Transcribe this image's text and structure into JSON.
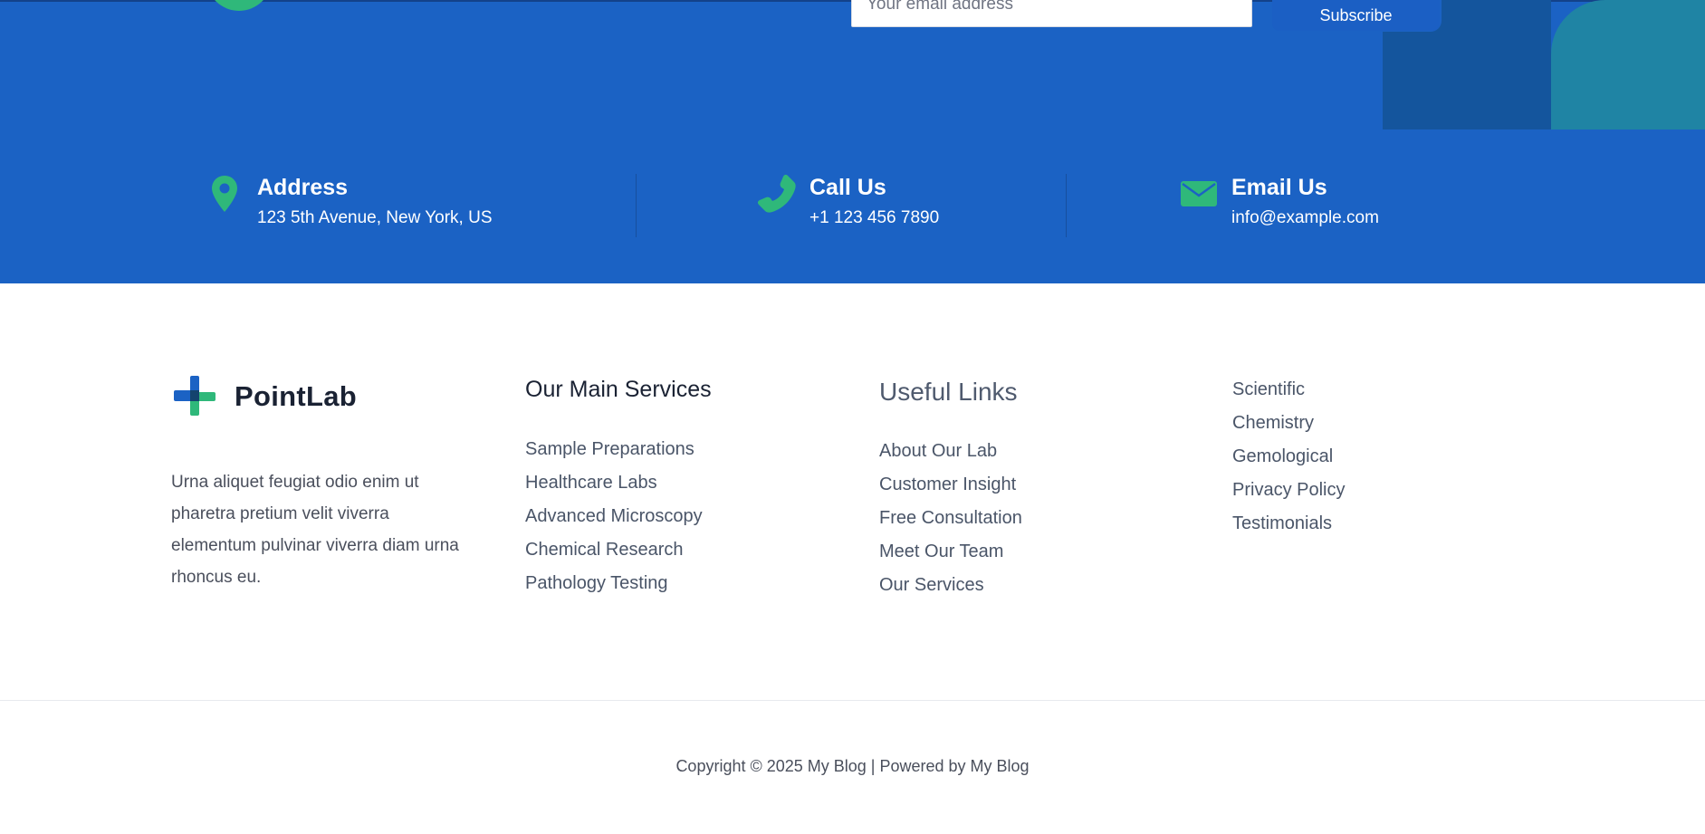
{
  "newsletter": {
    "email_placeholder": "Your email address",
    "subscribe_label": "Subscribe"
  },
  "contact": [
    {
      "title": "Address",
      "value": "123 5th Avenue, New York, US",
      "icon": "map-pin-icon"
    },
    {
      "title": "Call Us",
      "value": "+1 123 456 7890",
      "icon": "phone-icon"
    },
    {
      "title": "Email Us",
      "value": "info@example.com",
      "icon": "envelope-icon"
    }
  ],
  "brand": {
    "name": "PointLab",
    "description": "Urna aliquet feugiat odio enim ut pharetra pretium velit viverra elementum pulvinar viverra diam urna rhoncus eu."
  },
  "services": {
    "title": "Our Main Services",
    "items": [
      "Sample Preparations",
      "Healthcare Labs",
      "Advanced Microscopy",
      "Chemical Research",
      "Pathology Testing"
    ]
  },
  "useful_links": {
    "title": "Useful Links",
    "items": [
      "About Our Lab",
      "Customer Insight",
      "Free Consultation",
      "Meet Our Team",
      "Our Services"
    ]
  },
  "extra_links": {
    "items": [
      "Scientific",
      "Chemistry",
      "Gemological",
      "Privacy Policy",
      "Testimonials"
    ]
  },
  "copyright": "Copyright © 2025 My Blog | Powered by My Blog",
  "colors": {
    "primary_blue": "#1b62c4",
    "accent_green": "#2fb87a",
    "deco_dark_blue": "#14559d",
    "deco_teal": "#1f84a4"
  }
}
